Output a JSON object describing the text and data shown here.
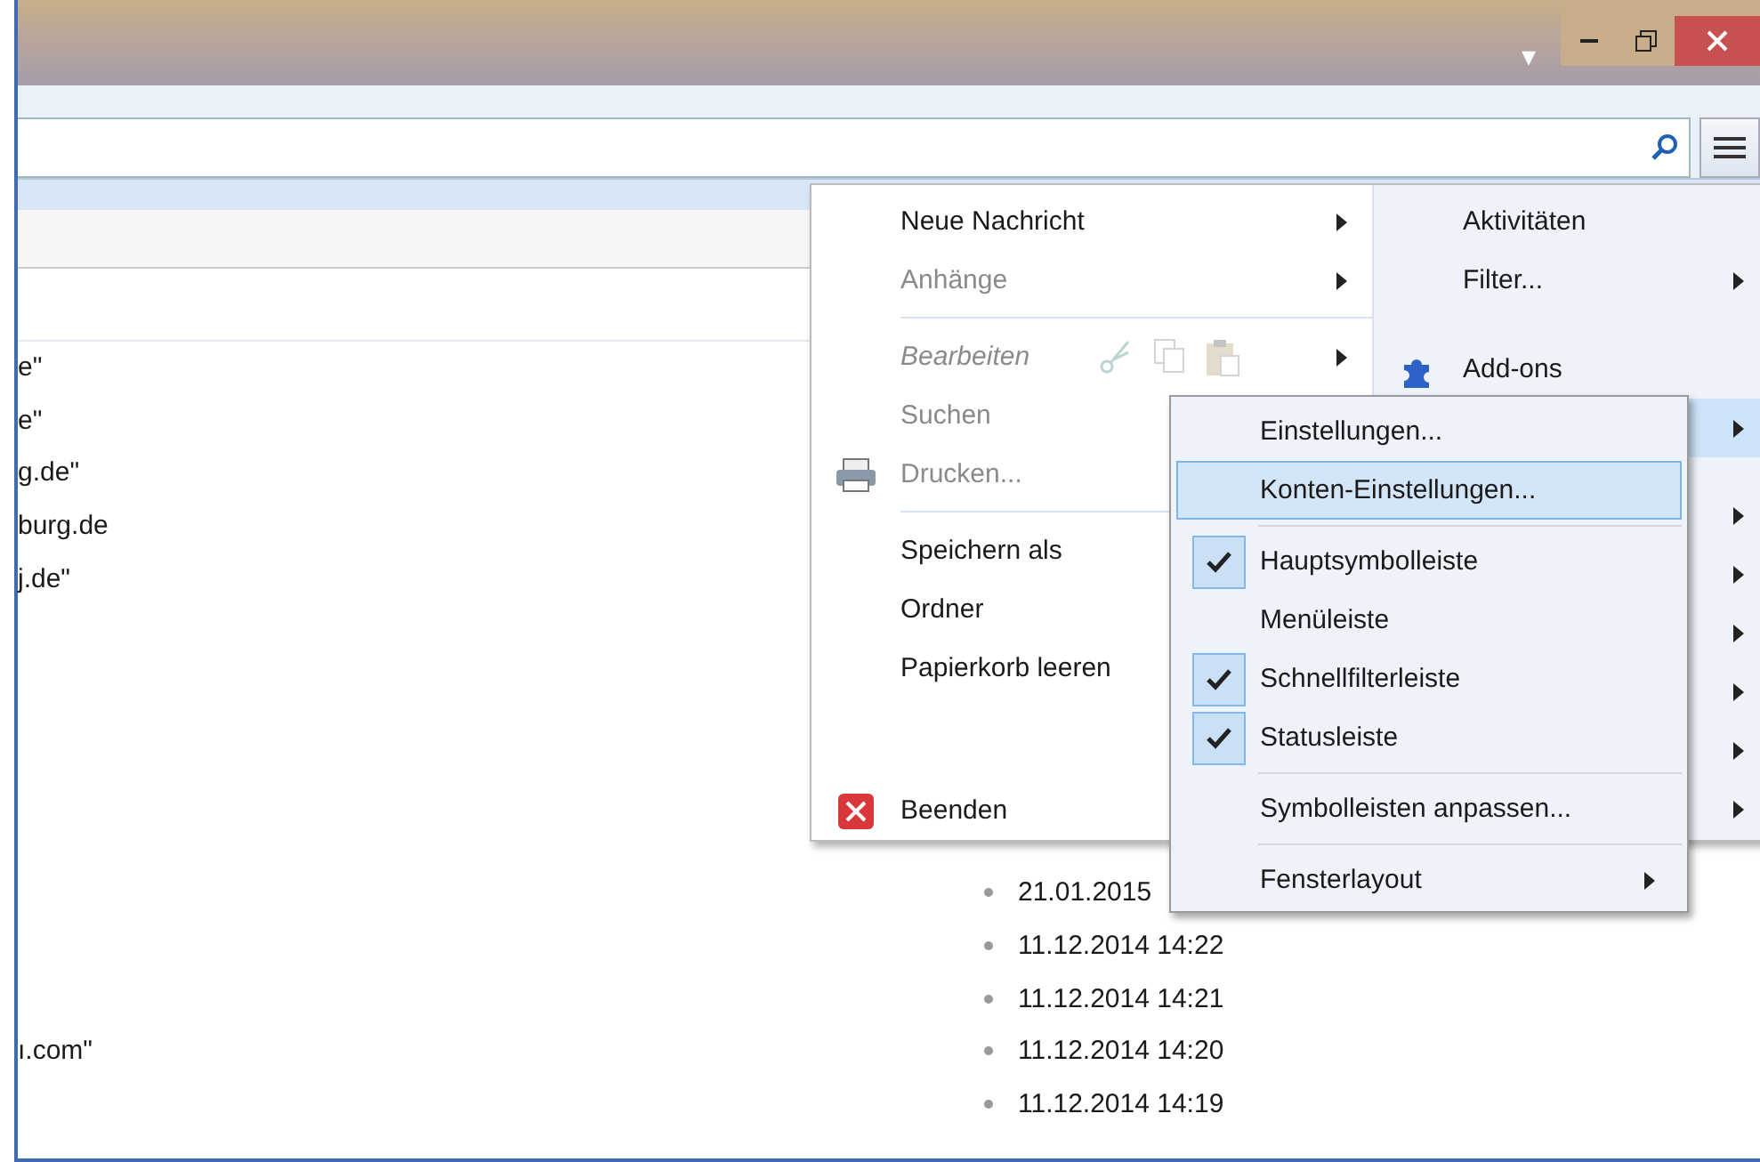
{
  "title_bar": {
    "dropdown": "▾"
  },
  "top_rows": [
    {
      "sender": "e\""
    },
    {
      "sender": "e\""
    },
    {
      "sender": "g.de\""
    },
    {
      "sender": "burg.de"
    },
    {
      "sender": "j.de\""
    }
  ],
  "bottom_rows": [
    {
      "date": "21.01.2015"
    },
    {
      "date": "11.12.2014 14:22"
    },
    {
      "date": "11.12.2014 14:21"
    },
    {
      "sender": "ı.com\"",
      "date": "11.12.2014 14:20"
    },
    {
      "date": "11.12.2014 14:19"
    }
  ],
  "app_menu": {
    "left": [
      {
        "kind": "item",
        "label": "Neue Nachricht",
        "disabled": false,
        "submenu": true
      },
      {
        "kind": "item",
        "label": "Anhänge",
        "disabled": true,
        "submenu": true
      },
      {
        "kind": "separator"
      },
      {
        "kind": "edit",
        "label": "Bearbeiten",
        "disabled": true,
        "submenu": true
      },
      {
        "kind": "item",
        "label": "Suchen",
        "disabled": true,
        "submenu": false
      },
      {
        "kind": "item",
        "label": "Drucken...",
        "disabled": true,
        "submenu": false
      },
      {
        "kind": "separator"
      },
      {
        "kind": "item",
        "label": "Speichern als",
        "disabled": false,
        "submenu": false
      },
      {
        "kind": "item",
        "label": "Ordner",
        "disabled": false,
        "submenu": false
      },
      {
        "kind": "item",
        "label": "Papierkorb leeren",
        "disabled": false,
        "submenu": false
      },
      {
        "kind": "spacer"
      },
      {
        "kind": "item",
        "label": "Beenden",
        "disabled": false,
        "submenu": false
      }
    ],
    "right": [
      {
        "kind": "item",
        "label": "Aktivitäten",
        "submenu": false,
        "selected": false
      },
      {
        "kind": "item",
        "label": "Filter...",
        "submenu": true,
        "selected": false
      },
      {
        "kind": "spacer"
      },
      {
        "kind": "item",
        "label": "Add-ons",
        "submenu": false,
        "selected": false
      },
      {
        "kind": "item",
        "submenu": true,
        "selected": true
      },
      {
        "kind": "spacer"
      },
      {
        "kind": "item",
        "submenu": true,
        "selected": false
      },
      {
        "kind": "item",
        "submenu": true,
        "selected": false
      },
      {
        "kind": "item",
        "submenu": true,
        "selected": false
      },
      {
        "kind": "item",
        "submenu": true,
        "selected": false
      },
      {
        "kind": "item",
        "submenu": true,
        "selected": false
      },
      {
        "kind": "item",
        "submenu": true,
        "selected": false
      }
    ]
  },
  "submenu": [
    {
      "kind": "item",
      "label": "Einstellungen...",
      "selected": false
    },
    {
      "kind": "item",
      "label": "Konten-Einstellungen...",
      "selected": true
    },
    {
      "kind": "separator"
    },
    {
      "kind": "check",
      "label": "Hauptsymbolleiste",
      "checked": true
    },
    {
      "kind": "check",
      "label": "Menüleiste",
      "checked": false
    },
    {
      "kind": "check",
      "label": "Schnellfilterleiste",
      "checked": true
    },
    {
      "kind": "check",
      "label": "Statusleiste",
      "checked": true
    },
    {
      "kind": "separator"
    },
    {
      "kind": "item",
      "label": "Symbolleisten anpassen...",
      "selected": false
    },
    {
      "kind": "separator"
    },
    {
      "kind": "item",
      "label": "Fensterlayout",
      "selected": false,
      "submenu": true
    }
  ]
}
